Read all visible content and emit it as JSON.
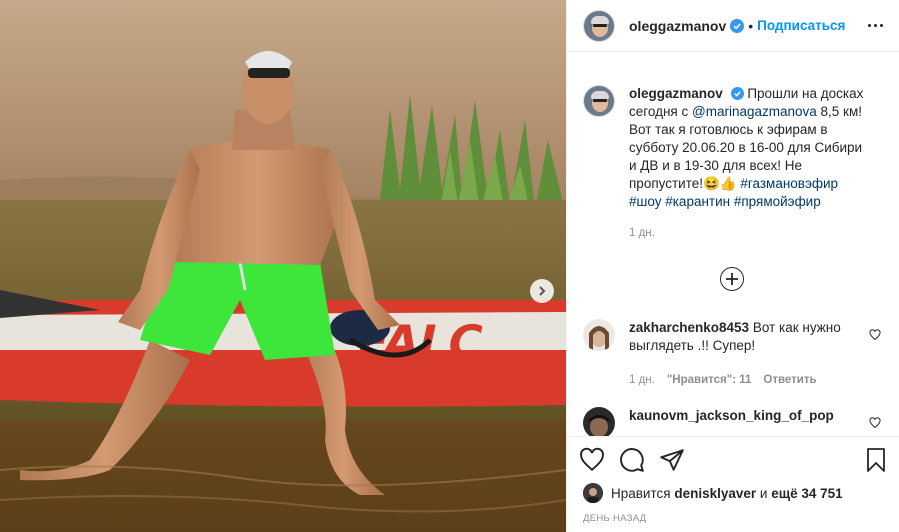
{
  "post": {
    "username": "oleggazmanov",
    "follow_label": "Подписаться",
    "header_separator": "•",
    "caption": {
      "text_before_mention": "Прошли на досках сегодня с ",
      "mention": "@marinagazmanova",
      "text_after_mention": " 8,5 км! Вот так я готовлюсь к эфирам в субботу 20.06.20 в 16-00 для Сибири и ДВ и в 19-30 для всех! Не пропустите!😆👍 ",
      "hashtags": [
        "#газмановэфир",
        "#шоу",
        "#карантин",
        "#прямойэфир"
      ],
      "time": "1 дн."
    },
    "photo": {
      "board_text": "FALC"
    }
  },
  "comments": [
    {
      "username": "zakharchenko8453",
      "text": "Вот как нужно выглядеть .!! Супер!",
      "time": "1 дн.",
      "likes_label": "\"Нравится\": 11",
      "reply_label": "Ответить"
    },
    {
      "username": "kaunovm_jackson_king_of_pop",
      "text": ""
    }
  ],
  "likes": {
    "prefix": "Нравится",
    "user": "denisklyaver",
    "middle": "и",
    "others": "ещё 34 751"
  },
  "date_label": "ДЕНЬ НАЗАД",
  "icons": {
    "verified": "verified-badge-icon",
    "more": "more-options-icon",
    "load_more": "plus-circle-icon",
    "like": "heart-icon",
    "comment": "comment-bubble-icon",
    "share": "paper-plane-icon",
    "save": "bookmark-icon",
    "next": "chevron-right-icon"
  },
  "colors": {
    "accent": "#0095f6",
    "link": "#00376b",
    "muted": "#8e8e8e",
    "verified": "#3897f0"
  }
}
